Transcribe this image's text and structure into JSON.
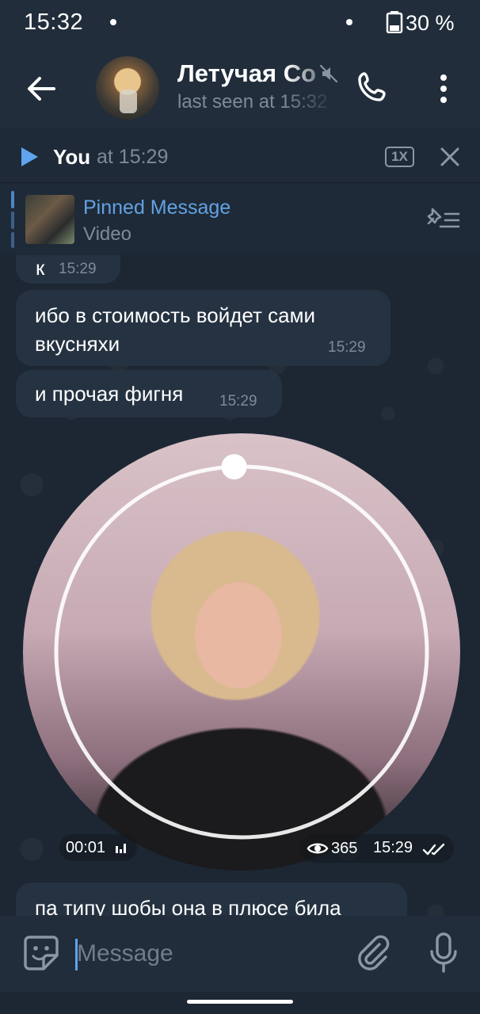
{
  "status_bar": {
    "time": "15:32",
    "battery": "30 %"
  },
  "header": {
    "title": "Летучая Со",
    "subtitle": "last seen at 15:32"
  },
  "player": {
    "sender": "You",
    "time_prefix": "at 15:29",
    "speed": "1X"
  },
  "pinned": {
    "label": "Pinned Message",
    "type": "Video"
  },
  "messages": [
    {
      "text": "к",
      "time": "15:29"
    },
    {
      "text_line1": "ибо в стоимость войдет сами",
      "text_line2": "вкусняхи",
      "time": "15:29"
    },
    {
      "text": "и прочая фигня",
      "time": "15:29"
    },
    {
      "type": "video_note",
      "duration": "00:01",
      "views": "365",
      "time": "15:29",
      "progress": 0.0
    },
    {
      "text": "па типу шобы она в плюсе била"
    }
  ],
  "composer": {
    "placeholder": "Message"
  },
  "colors": {
    "accent": "#63a2e3",
    "bubble": "#253241",
    "header": "#212d3b",
    "background": "#1c2733"
  }
}
